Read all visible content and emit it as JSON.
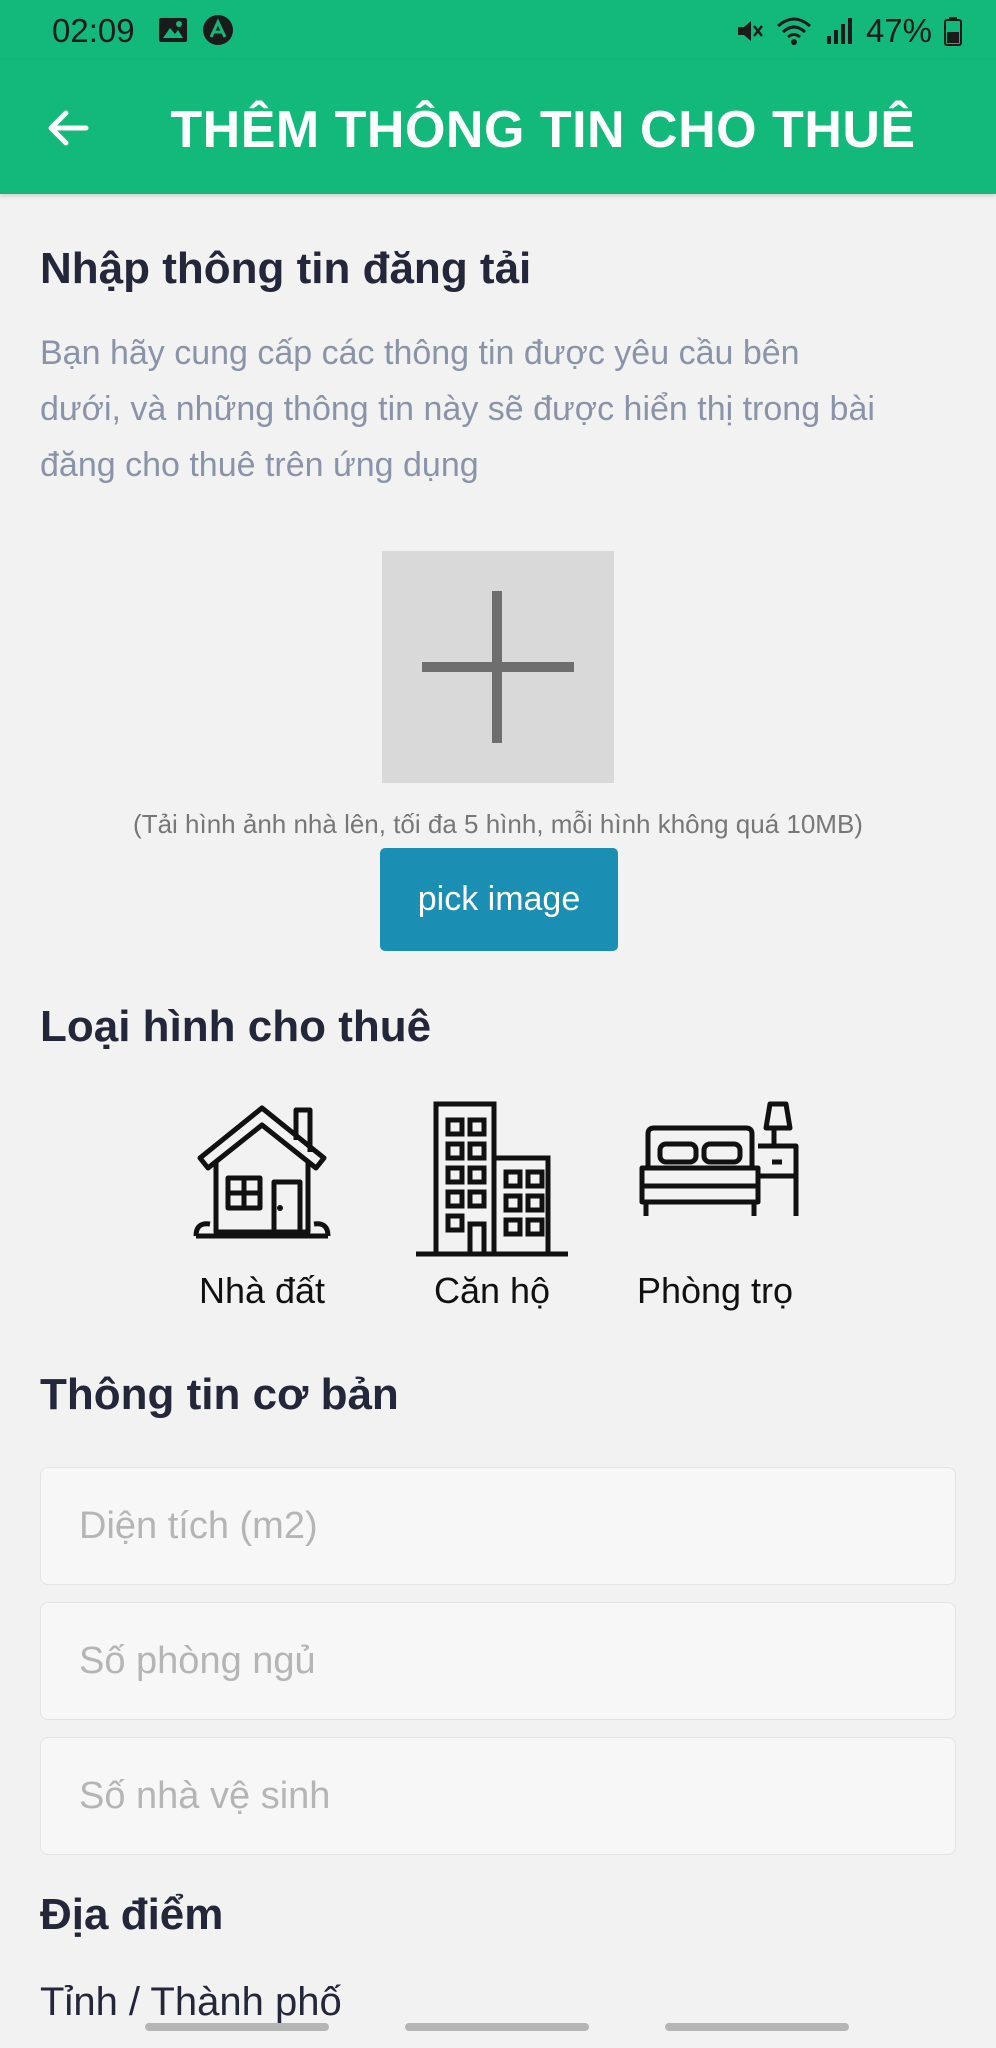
{
  "status": {
    "time": "02:09",
    "battery": "47%"
  },
  "app_bar": {
    "title": "THÊM THÔNG TIN CHO THUÊ"
  },
  "intro": {
    "title": "Nhập thông tin đăng tải",
    "line1": "Bạn hãy cung cấp các thông tin được yêu cầu bên",
    "line2": "dưới, và những thông tin này sẽ được hiển thị trong bài",
    "line3": "đăng cho thuê trên ứng dụng"
  },
  "upload": {
    "hint": "(Tải hình ảnh nhà lên, tối đa 5 hình, mỗi hình không quá 10MB)",
    "button_label": "pick image"
  },
  "rental_type": {
    "title": "Loại hình cho thuê",
    "options": [
      {
        "label": "Nhà đất",
        "icon": "house-icon"
      },
      {
        "label": "Căn hộ",
        "icon": "apartment-building-icon"
      },
      {
        "label": "Phòng trọ",
        "icon": "bedroom-icon"
      }
    ]
  },
  "basic_info": {
    "title": "Thông tin cơ bản",
    "area_placeholder": "Diện tích (m2)",
    "bedrooms_placeholder": "Số phòng ngủ",
    "bathrooms_placeholder": "Số nhà vệ sinh"
  },
  "location": {
    "title": "Địa điểm",
    "province_label": "Tỉnh / Thành phố"
  },
  "colors": {
    "accent": "#12b97a",
    "button": "#1a8fb3"
  }
}
